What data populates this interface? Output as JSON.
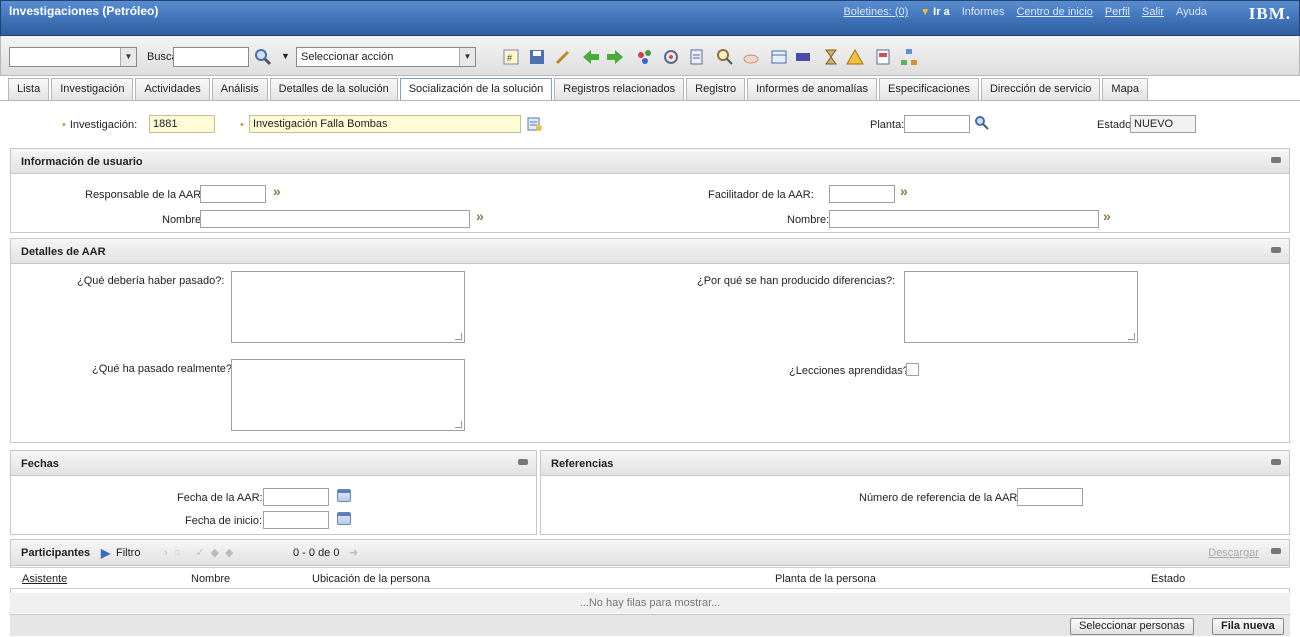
{
  "app": {
    "title": "Investigaciones (Petróleo)",
    "brand": "IBM."
  },
  "top_links": {
    "bulletins": "Boletines: (0)",
    "goto": "Ir a",
    "reports": "Informes",
    "start_center": "Centro de inicio",
    "profile": "Perfil",
    "logout": "Salir",
    "help": "Ayuda"
  },
  "toolbar": {
    "search_label": "Buscar:",
    "action_select": "Seleccionar acción"
  },
  "tabs": [
    "Lista",
    "Investigación",
    "Actividades",
    "Análisis",
    "Detalles de la solución",
    "Socialización de la solución",
    "Registros relacionados",
    "Registro",
    "Informes de anomalías",
    "Especificaciones",
    "Dirección de servicio",
    "Mapa"
  ],
  "active_tab_index": 5,
  "header": {
    "investigation_label": "Investigación:",
    "investigation_value": "1881",
    "description_value": "Investigación Falla Bombas",
    "plant_label": "Planta:",
    "plant_value": "",
    "status_label": "Estado:",
    "status_value": "NUEVO"
  },
  "user_info": {
    "title": "Información de usuario",
    "responsible_label": "Responsable de la AAR:",
    "responsible_name_label": "Nombre:",
    "facilitator_label": "Facilitador de la AAR:",
    "facilitator_name_label": "Nombre:"
  },
  "aar_details": {
    "title": "Detalles de AAR",
    "should_label": "¿Qué debería haber pasado?:",
    "actual_label": "¿Qué ha pasado realmente?:",
    "diff_label": "¿Por qué se han producido diferencias?:",
    "lessons_label": "¿Lecciones aprendidas?"
  },
  "dates": {
    "title": "Fechas",
    "aar_date_label": "Fecha de la AAR:",
    "start_date_label": "Fecha de inicio:"
  },
  "references": {
    "title": "Referencias",
    "ref_label": "Número de referencia de la AAR:"
  },
  "participants": {
    "title": "Participantes",
    "filter": "Filtro",
    "count": "0 - 0 de 0",
    "download": "Descargar",
    "columns": [
      "Asistente",
      "Nombre",
      "Ubicación de la persona",
      "Planta de la persona",
      "Estado"
    ],
    "empty_message": "...No hay filas para mostrar...",
    "select_people_button": "Seleccionar personas",
    "new_row_button": "Fila nueva"
  },
  "colors": {
    "titlebar": "#3f72b8",
    "required_field": "#fffbd6",
    "accent": "#c09a40"
  }
}
